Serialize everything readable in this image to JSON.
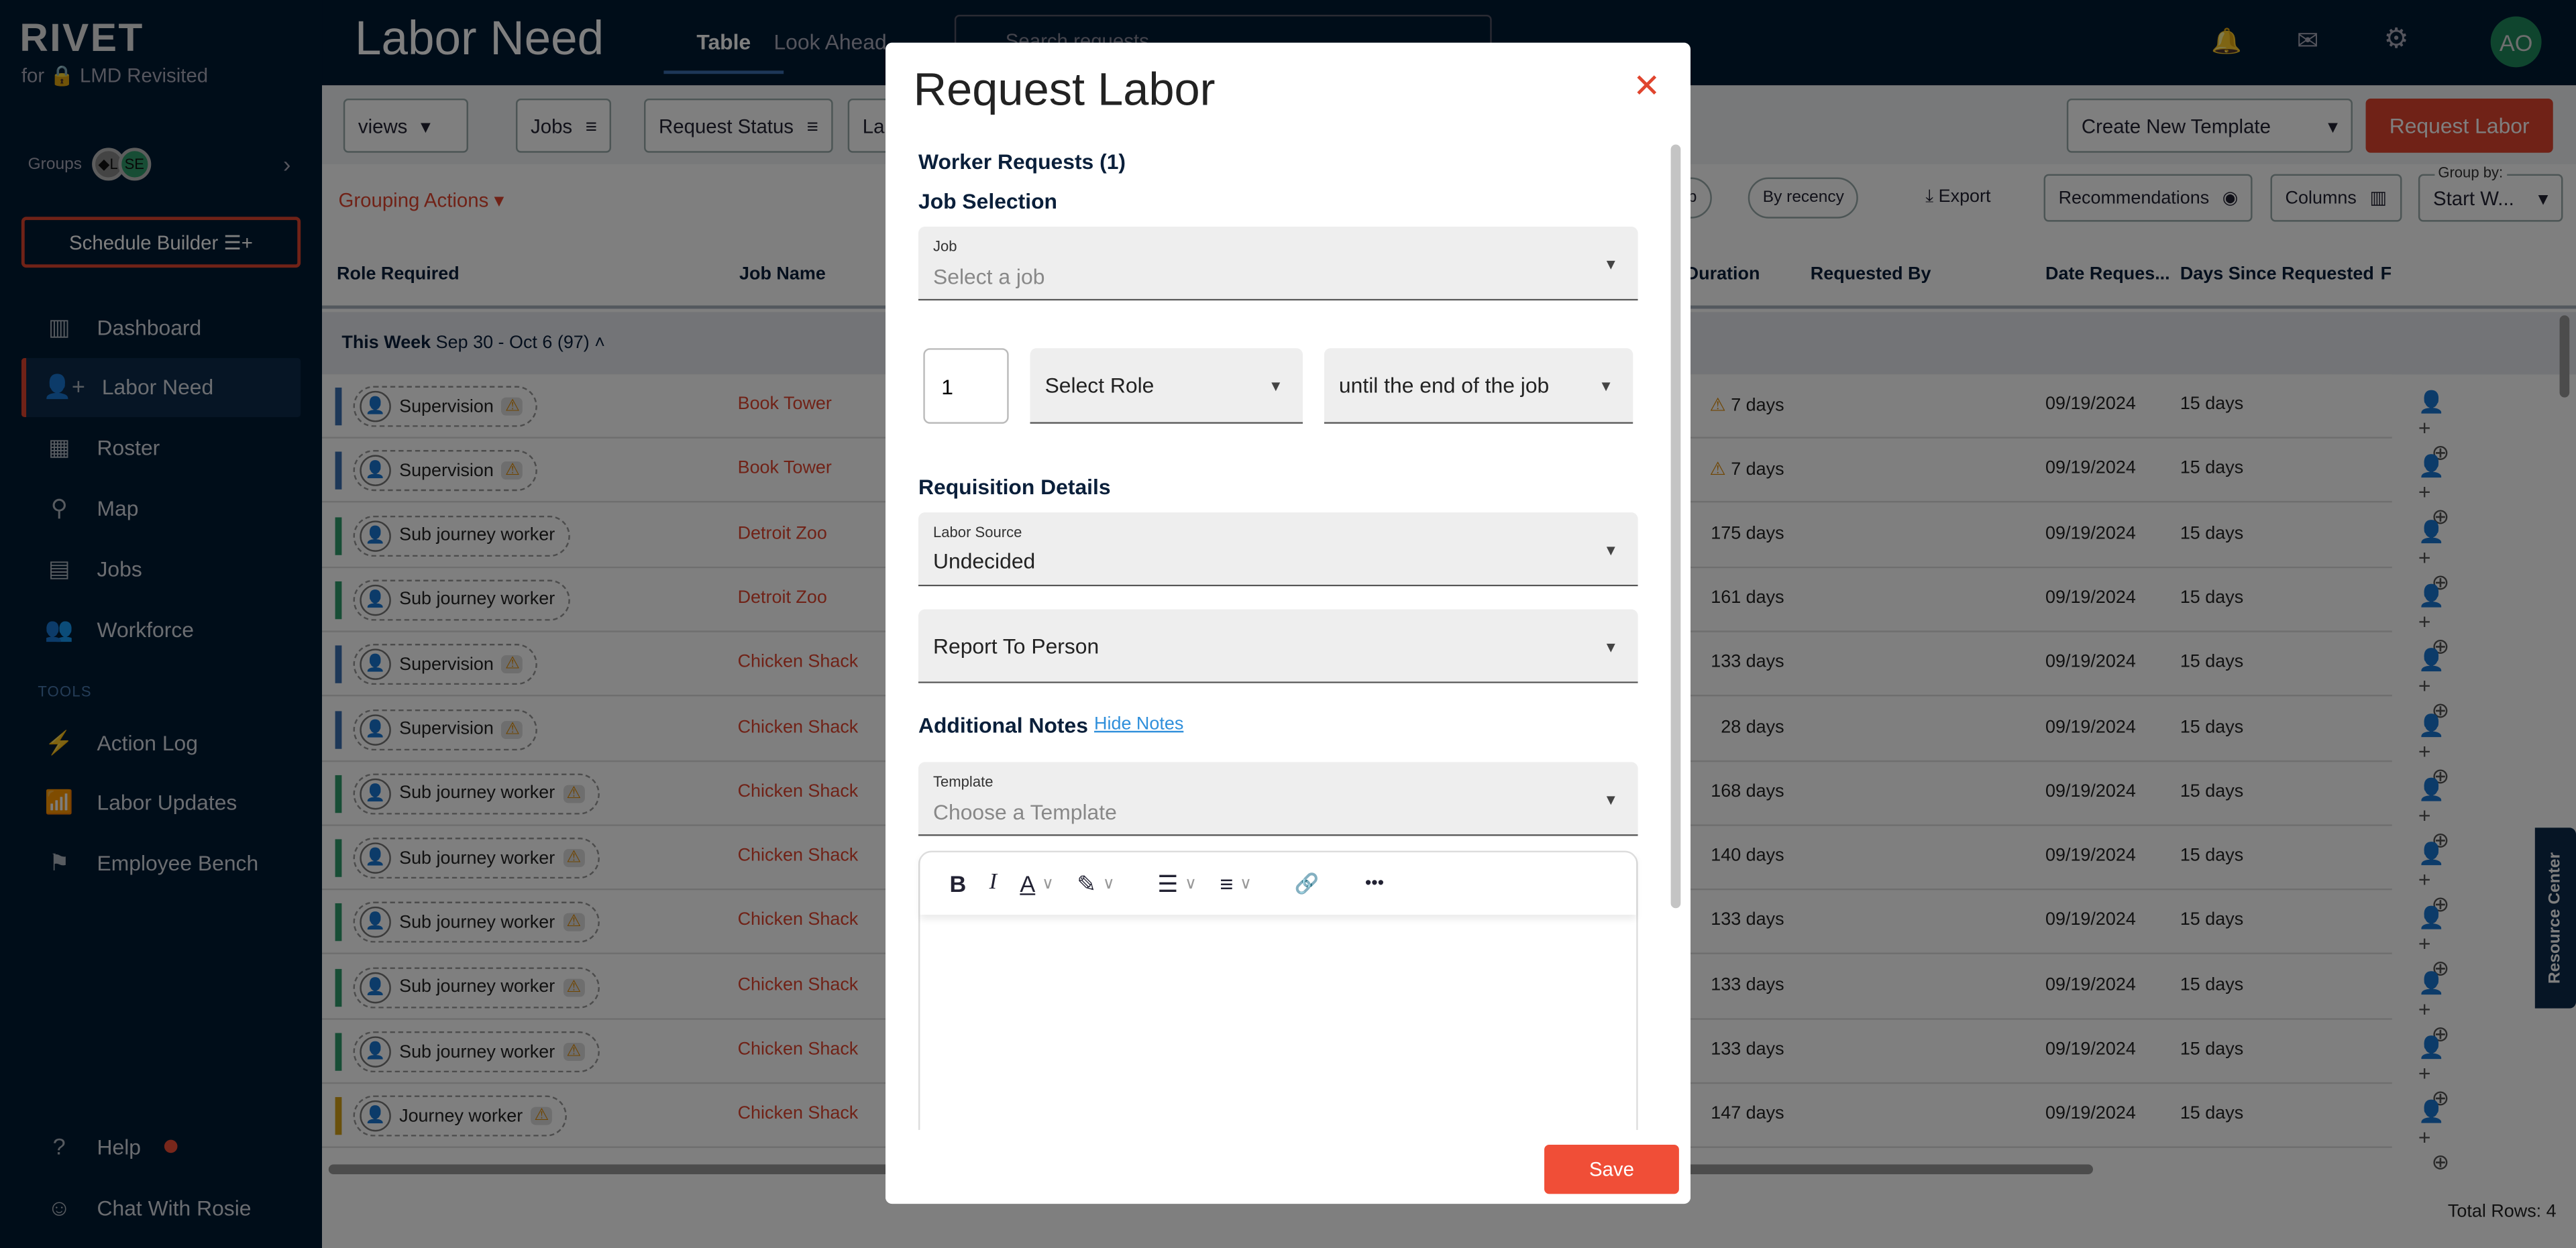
{
  "sidebar": {
    "logo": "RIVET",
    "subtitle": "for 🔒 LMD Revisited",
    "groups_label": "Groups",
    "group_avatars": [
      "◆L",
      "SE"
    ],
    "schedule_builder": "Schedule Builder ☰+",
    "nav": [
      {
        "label": "Dashboard",
        "icon": "▥"
      },
      {
        "label": "Labor Need",
        "icon": "👤+"
      },
      {
        "label": "Roster",
        "icon": "▦"
      },
      {
        "label": "Map",
        "icon": "⚲"
      },
      {
        "label": "Jobs",
        "icon": "▤"
      },
      {
        "label": "Workforce",
        "icon": "👥"
      }
    ],
    "tools_label": "TOOLS",
    "tools": [
      {
        "label": "Action Log",
        "icon": "⚡"
      },
      {
        "label": "Labor Updates",
        "icon": "📶"
      },
      {
        "label": "Employee Bench",
        "icon": "⚑"
      }
    ],
    "help": "Help",
    "chat": "Chat With Rosie"
  },
  "header": {
    "title": "Labor Need",
    "tabs": [
      "Table",
      "Look Ahead"
    ],
    "search_placeholder": "Search requests",
    "avatar": "AO"
  },
  "toolbar": {
    "views": "views",
    "filters": [
      "Jobs",
      "Request Status",
      "La"
    ],
    "create_template": "Create New Template",
    "request_labor": "Request Labor",
    "grouping_actions": "Grouping Actions",
    "sort_job": "By job",
    "sort_recency": "By recency",
    "export": "Export",
    "recommendations": "Recommendations",
    "columns": "Columns",
    "group_by_label": "Group by:",
    "group_by_value": "Start W..."
  },
  "table": {
    "columns": [
      "Role Required",
      "Job Name",
      "Duration",
      "Requested By",
      "Date Reques...",
      "Days Since Requested",
      "F"
    ],
    "group": {
      "label": "This Week",
      "range": "Sep 30 - Oct 6 (97)"
    },
    "rows": [
      {
        "role": "Supervision",
        "color": "#3b6fb0",
        "warn": true,
        "job": "Book Tower",
        "duration": "7 days",
        "dwarn": true,
        "date": "09/19/2024",
        "since": "15 days"
      },
      {
        "role": "Supervision",
        "color": "#3b6fb0",
        "warn": true,
        "job": "Book Tower",
        "duration": "7 days",
        "dwarn": true,
        "date": "09/19/2024",
        "since": "15 days"
      },
      {
        "role": "Sub journey worker",
        "color": "#2e9a6a",
        "warn": false,
        "job": "Detroit Zoo",
        "duration": "175 days",
        "dwarn": false,
        "date": "09/19/2024",
        "since": "15 days"
      },
      {
        "role": "Sub journey worker",
        "color": "#2e9a6a",
        "warn": false,
        "job": "Detroit Zoo",
        "duration": "161 days",
        "dwarn": false,
        "date": "09/19/2024",
        "since": "15 days"
      },
      {
        "role": "Supervision",
        "color": "#3b6fb0",
        "warn": true,
        "job": "Chicken Shack",
        "duration": "133 days",
        "dwarn": false,
        "date": "09/19/2024",
        "since": "15 days"
      },
      {
        "role": "Supervision",
        "color": "#3b6fb0",
        "warn": true,
        "job": "Chicken Shack",
        "duration": "28 days",
        "dwarn": false,
        "date": "09/19/2024",
        "since": "15 days"
      },
      {
        "role": "Sub journey worker",
        "color": "#2e9a6a",
        "warn": true,
        "job": "Chicken Shack",
        "duration": "168 days",
        "dwarn": false,
        "date": "09/19/2024",
        "since": "15 days"
      },
      {
        "role": "Sub journey worker",
        "color": "#2e9a6a",
        "warn": true,
        "job": "Chicken Shack",
        "duration": "140 days",
        "dwarn": false,
        "date": "09/19/2024",
        "since": "15 days"
      },
      {
        "role": "Sub journey worker",
        "color": "#2e9a6a",
        "warn": true,
        "job": "Chicken Shack",
        "duration": "133 days",
        "dwarn": false,
        "date": "09/19/2024",
        "since": "15 days"
      },
      {
        "role": "Sub journey worker",
        "color": "#2e9a6a",
        "warn": true,
        "job": "Chicken Shack",
        "duration": "133 days",
        "dwarn": false,
        "date": "09/19/2024",
        "since": "15 days"
      },
      {
        "role": "Sub journey worker",
        "color": "#2e9a6a",
        "warn": true,
        "job": "Chicken Shack",
        "duration": "133 days",
        "dwarn": false,
        "date": "09/19/2024",
        "since": "15 days"
      },
      {
        "role": "Journey worker",
        "color": "#d4a017",
        "warn": true,
        "job": "Chicken Shack",
        "duration": "147 days",
        "dwarn": false,
        "date": "09/19/2024",
        "since": "15 days"
      }
    ],
    "total_rows": "Total Rows: 4"
  },
  "resource_center": "Resource Center",
  "modal": {
    "title": "Request Labor",
    "worker_requests": "Worker Requests (1)",
    "job_selection": "Job Selection",
    "job_label": "Job",
    "job_placeholder": "Select a job",
    "quantity": "1",
    "role_placeholder": "Select Role",
    "duration_value": "until the end of the job",
    "requisition_details": "Requisition Details",
    "labor_source_label": "Labor Source",
    "labor_source_value": "Undecided",
    "report_to": "Report To Person",
    "additional_notes": "Additional Notes",
    "hide_notes": "Hide Notes",
    "template_label": "Template",
    "template_placeholder": "Choose a Template",
    "editor_tools": [
      "B",
      "I",
      "A",
      "✎",
      "☰",
      "≡",
      "🔗",
      "•••"
    ],
    "save": "Save"
  },
  "colors": {
    "brand_dark": "#001a33",
    "accent": "#e0452e"
  }
}
